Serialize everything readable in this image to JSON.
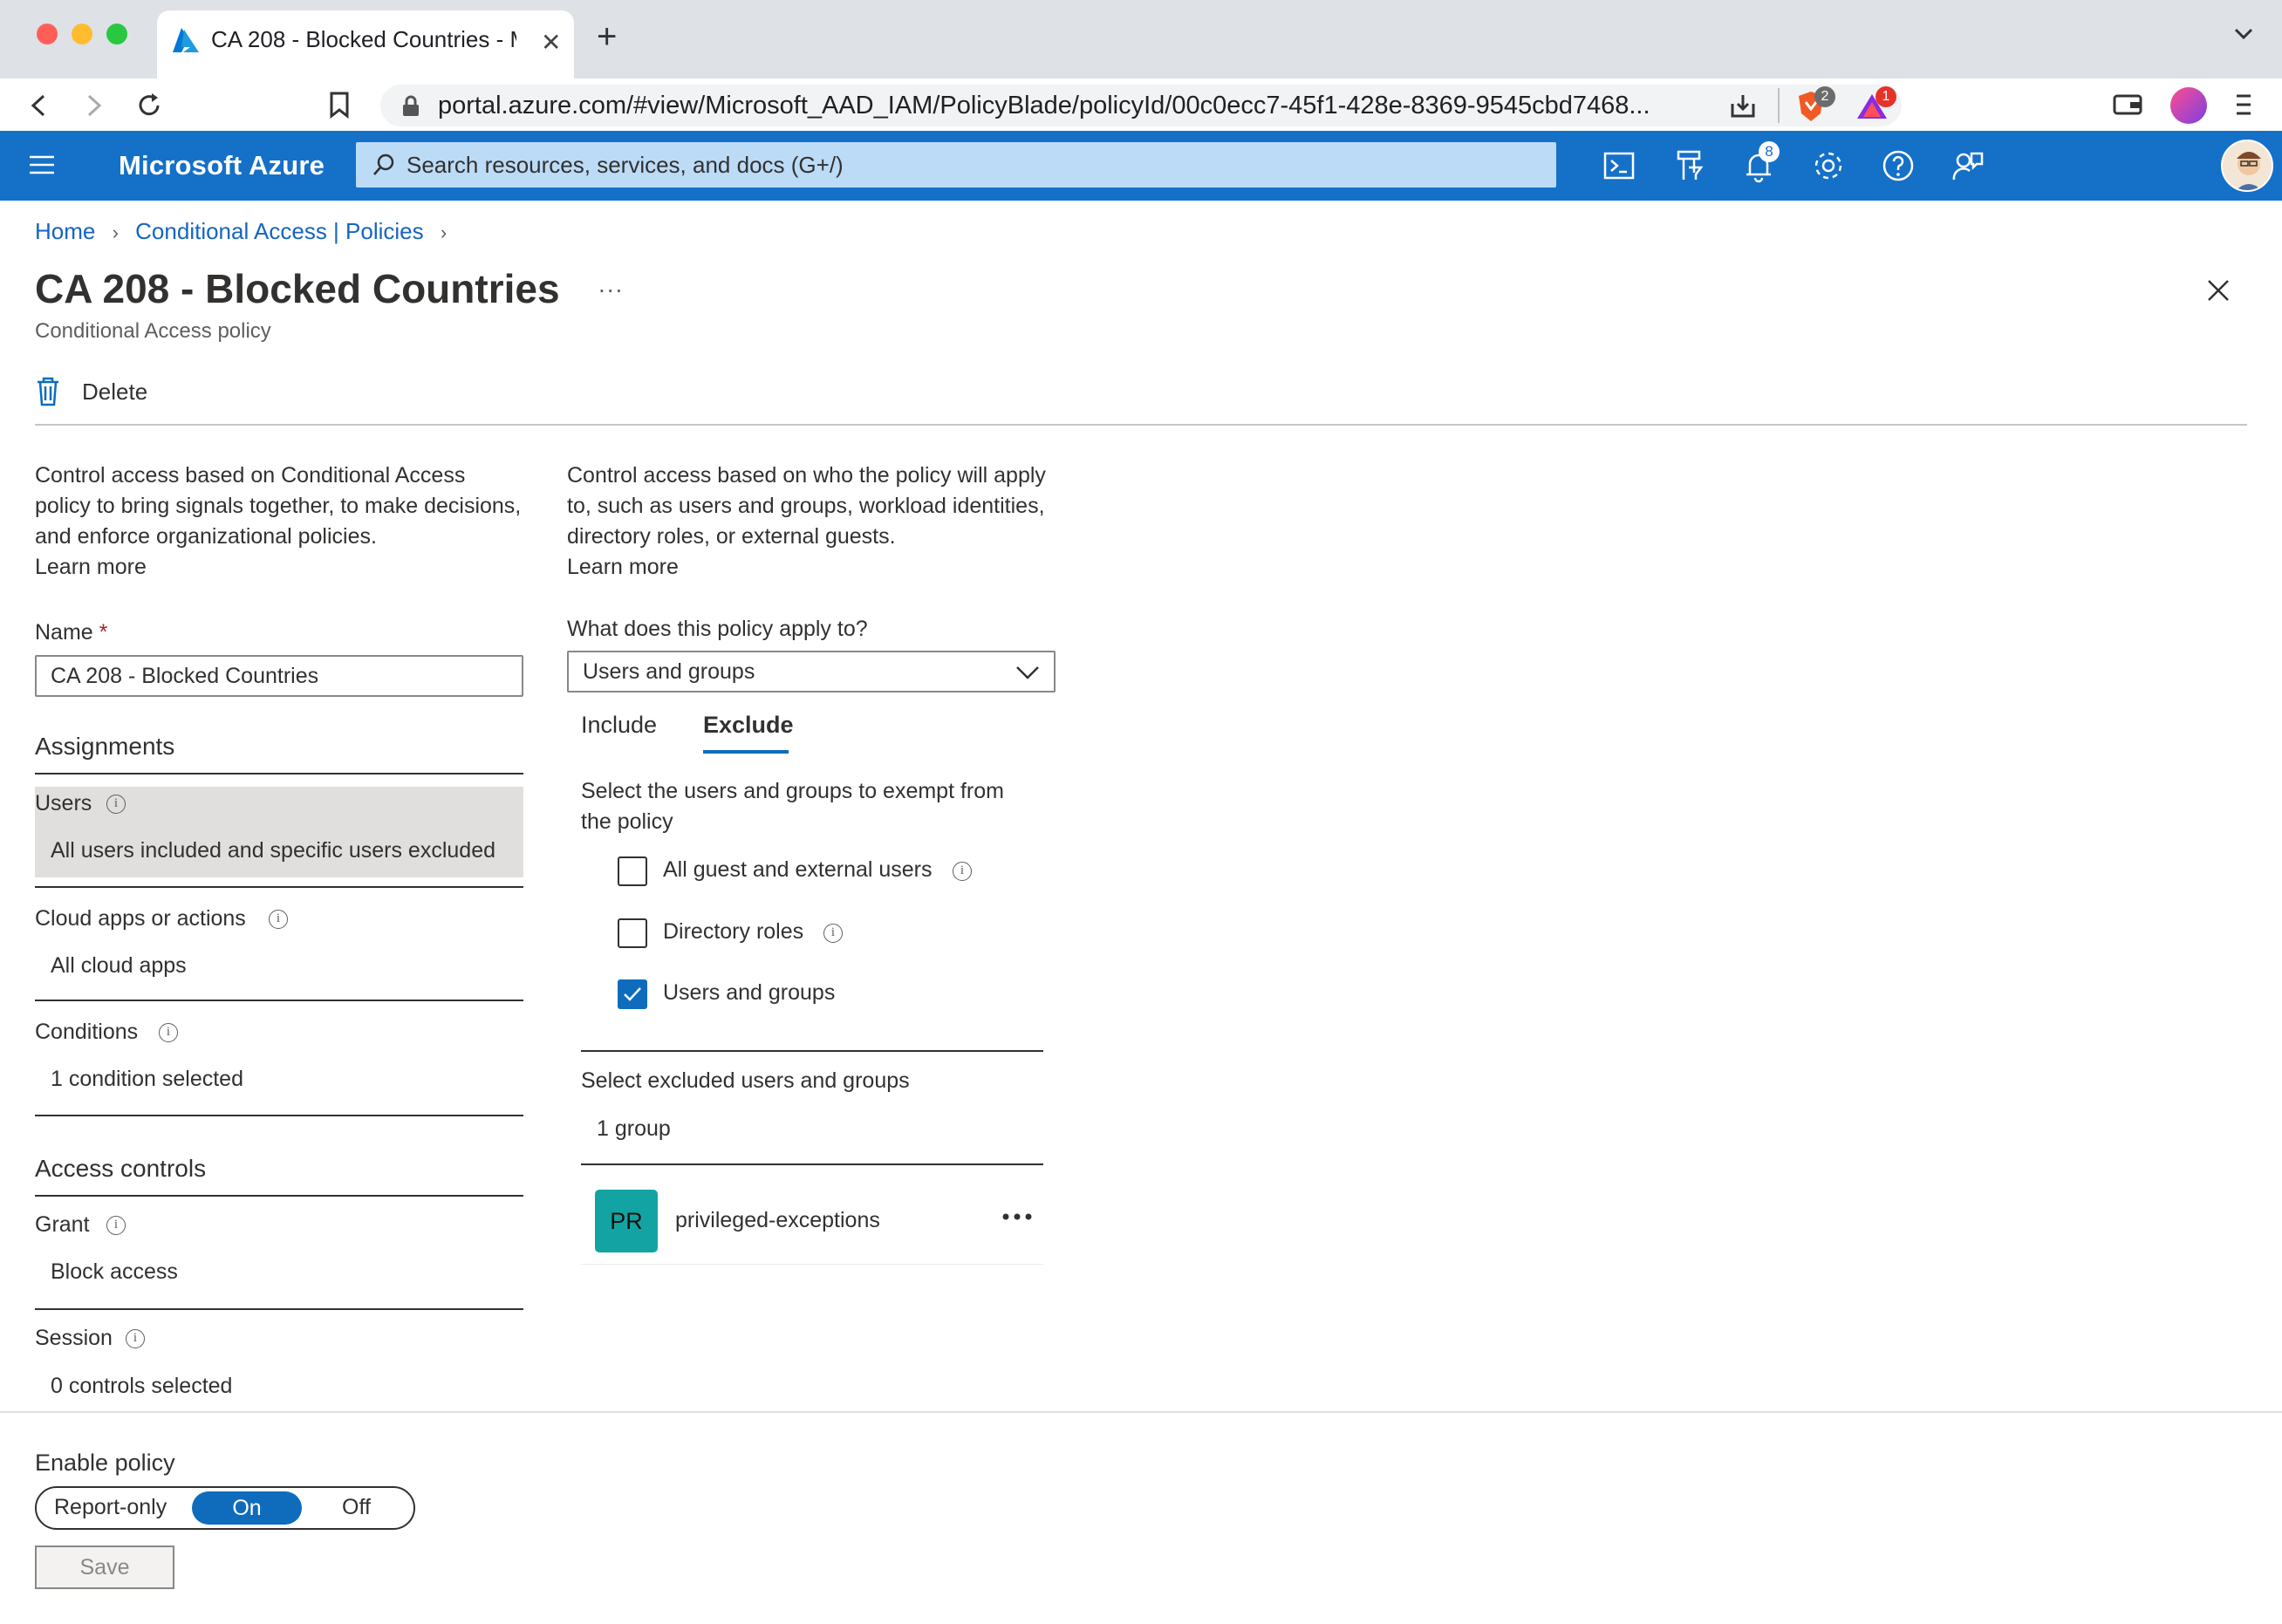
{
  "browser": {
    "tab_title": "CA 208 - Blocked Countries - M",
    "url": "portal.azure.com/#view/Microsoft_AAD_IAM/PolicyBlade/policyId/00c0ecc7-45f1-428e-8369-9545cbd7468...",
    "brave_badge": "2",
    "rewards_badge": "1"
  },
  "azure": {
    "brand": "Microsoft Azure",
    "search_placeholder": "Search resources, services, and docs (G+/)",
    "notifications_count": "8"
  },
  "breadcrumb": {
    "home": "Home",
    "policies": "Conditional Access | Policies"
  },
  "page": {
    "title": "CA 208 - Blocked Countries",
    "subtitle": "Conditional Access policy",
    "more": "...",
    "delete_label": "Delete"
  },
  "left": {
    "intro": "Control access based on Conditional Access policy to bring signals together, to make decisions, and enforce organizational policies.",
    "learn_more": "Learn more",
    "name_label": "Name",
    "required": "*",
    "name_value": "CA 208 - Blocked Countries",
    "assignments_heading": "Assignments",
    "users_label": "Users",
    "users_value": "All users included and specific users excluded",
    "cloud_label": "Cloud apps or actions",
    "cloud_value": "All cloud apps",
    "conditions_label": "Conditions",
    "conditions_value": "1 condition selected",
    "access_heading": "Access controls",
    "grant_label": "Grant",
    "grant_value": "Block access",
    "session_label": "Session",
    "session_value": "0 controls selected"
  },
  "right": {
    "intro": "Control access based on who the policy will apply to, such as users and groups, workload identities, directory roles, or external guests.",
    "learn_more": "Learn more",
    "applies_label": "What does this policy apply to?",
    "applies_value": "Users and groups",
    "tab_include": "Include",
    "tab_exclude": "Exclude",
    "exempt_text": "Select the users and groups to exempt from the policy",
    "options": [
      {
        "label": "All guest and external users",
        "checked": false
      },
      {
        "label": "Directory roles",
        "checked": false
      },
      {
        "label": "Users and groups",
        "checked": true
      }
    ],
    "excluded_label": "Select excluded users and groups",
    "excluded_value": "1 group",
    "group_initials": "PR",
    "group_name": "privileged-exceptions"
  },
  "footer": {
    "enable_label": "Enable policy",
    "toggle": [
      "Report-only",
      "On",
      "Off"
    ],
    "selected": "On",
    "save_label": "Save"
  },
  "colors": {
    "azure_blue": "#1570c8",
    "link": "#1565c0",
    "avatar_teal": "#14a3a3"
  }
}
